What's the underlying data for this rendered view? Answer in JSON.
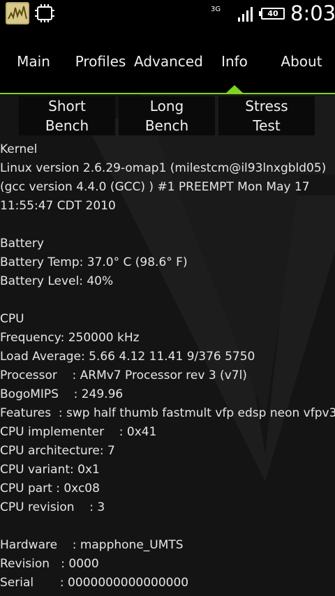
{
  "status_bar": {
    "network": "3G",
    "battery_level": "40",
    "time": "8:03",
    "icons": [
      "app-graph-icon",
      "cpu-chip-icon",
      "signal-icon",
      "battery-icon"
    ]
  },
  "tabs": [
    {
      "label": "Main",
      "selected": false
    },
    {
      "label": "Profiles",
      "selected": false
    },
    {
      "label": "Advanced",
      "selected": false
    },
    {
      "label": "Info",
      "selected": true
    },
    {
      "label": "About",
      "selected": false
    }
  ],
  "bench_buttons": [
    {
      "line1": "Short",
      "line2": "Bench"
    },
    {
      "line1": "Long",
      "line2": "Bench"
    },
    {
      "line1": "Stress",
      "line2": "Test"
    }
  ],
  "colors": {
    "accent": "#7ed321",
    "background": "#141414"
  },
  "info": {
    "kernel": {
      "header": "Kernel",
      "line1": "Linux version 2.6.29-omap1 (milestcm@il93lnxgbld05)",
      "line2": "(gcc version 4.4.0 (GCC) ) #1 PREEMPT Mon May 17",
      "line3": "11:55:47 CDT 2010"
    },
    "battery": {
      "header": "Battery",
      "temp": "Battery Temp: 37.0° C (98.6° F)",
      "level": "Battery Level: 40%"
    },
    "cpu": {
      "header": "CPU",
      "frequency": "Frequency: 250000 kHz",
      "load": "Load Average: 5.66 4.12 11.41 9/376 5750",
      "processor": "Processor    : ARMv7 Processor rev 3 (v7l)",
      "bogomips": "BogoMIPS    : 249.96",
      "features": "Features  : swp half thumb fastmult vfp edsp neon vfpv3",
      "implementer": "CPU implementer    : 0x41",
      "architecture": "CPU architecture: 7",
      "variant": "CPU variant: 0x1",
      "part": "CPU part : 0xc08",
      "revision": "CPU revision    : 3"
    },
    "hardware": {
      "hardware": "Hardware    : mapphone_UMTS",
      "revision": "Revision   : 0000",
      "serial": "Serial       : 0000000000000000"
    }
  }
}
